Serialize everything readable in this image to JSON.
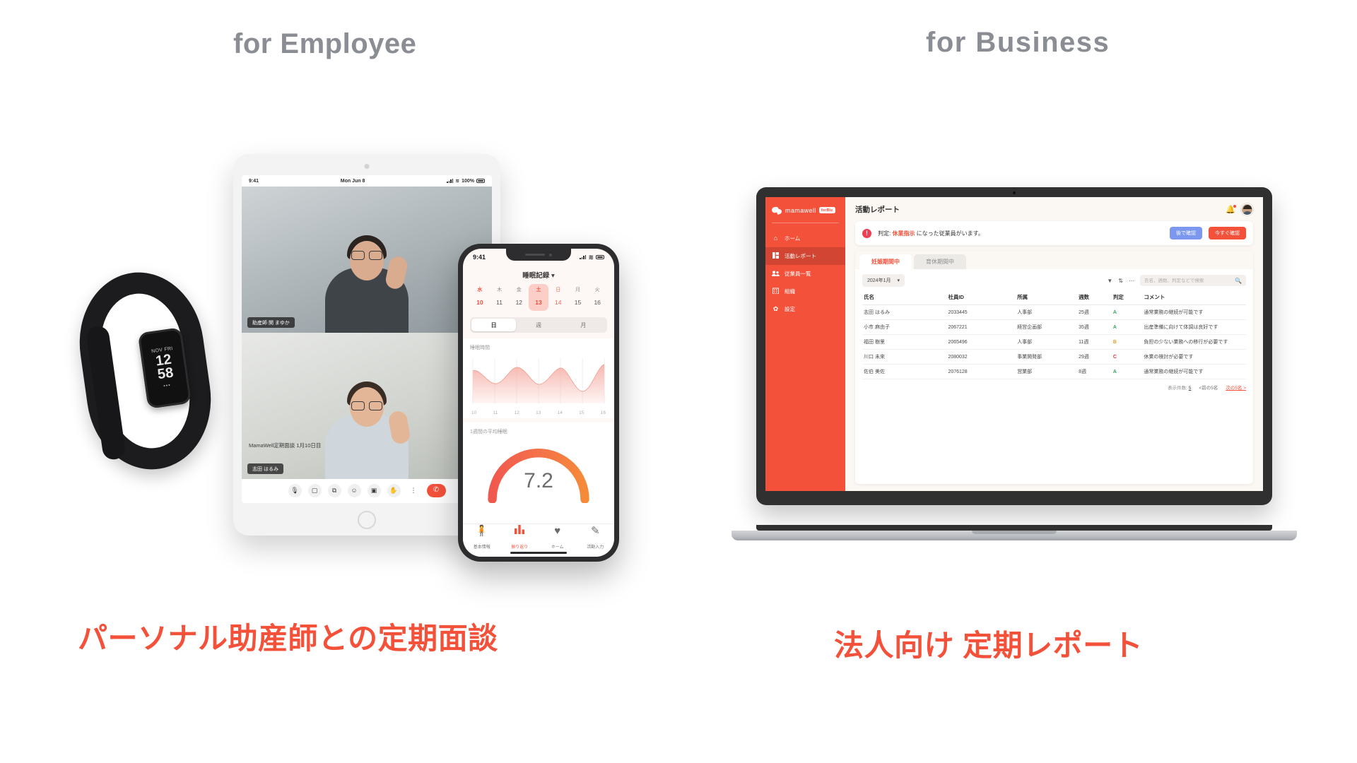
{
  "headings": {
    "employee": "for Employee",
    "business": "for  Business"
  },
  "captions": {
    "left": "パーソナル助産師との定期面談",
    "right": "法人向け 定期レポート"
  },
  "band": {
    "date": "NOV FRI",
    "time_top": "12",
    "time_bottom": "58",
    "dots": "•••"
  },
  "tablet": {
    "status": {
      "time": "9:41",
      "date": "Mon Jun 8",
      "battery": "100%"
    },
    "participants": [
      {
        "name": "助産師 関 まゆか"
      },
      {
        "name": "志田 はるみ"
      }
    ],
    "meeting_title": "MamaWell定期面談 1月10日目",
    "call_buttons": [
      {
        "icon": "microphone-icon",
        "glyph": "🎙"
      },
      {
        "icon": "video-icon",
        "glyph": "▢"
      },
      {
        "icon": "screen-share-icon",
        "glyph": "⧉"
      },
      {
        "icon": "emoji-icon",
        "glyph": "☺"
      },
      {
        "icon": "layout-icon",
        "glyph": "▣"
      },
      {
        "icon": "raise-hand-icon",
        "glyph": "✋"
      },
      {
        "icon": "more-icon",
        "glyph": "⋮"
      },
      {
        "icon": "end-call-icon",
        "glyph": "✆"
      }
    ]
  },
  "phone": {
    "status": {
      "time": "9:41"
    },
    "title": "睡眠記録",
    "title_caret": "▾",
    "days": [
      {
        "dow": "水",
        "num": "10",
        "selected": false,
        "sunday": false
      },
      {
        "dow": "木",
        "num": "11",
        "selected": false,
        "sunday": false
      },
      {
        "dow": "金",
        "num": "12",
        "selected": false,
        "sunday": false
      },
      {
        "dow": "土",
        "num": "13",
        "selected": true,
        "sunday": false
      },
      {
        "dow": "日",
        "num": "14",
        "selected": false,
        "sunday": true
      },
      {
        "dow": "月",
        "num": "15",
        "selected": false,
        "sunday": false
      },
      {
        "dow": "火",
        "num": "16",
        "selected": false,
        "sunday": false
      }
    ],
    "segments": [
      {
        "label": "日",
        "active": true
      },
      {
        "label": "週",
        "active": false
      },
      {
        "label": "月",
        "active": false
      }
    ],
    "chart_label": "睡眠時間",
    "gauge_label": "1週間の平均睡眠",
    "gauge_value": "7.2",
    "tabbar": [
      {
        "label": "基本情報",
        "icon": "pregnant-person-icon",
        "glyph": "🧍",
        "active": false
      },
      {
        "label": "振り返り",
        "icon": "bar-chart-icon",
        "glyph": "▮",
        "active": true
      },
      {
        "label": "ホーム",
        "icon": "heart-icon",
        "glyph": "♥",
        "active": false
      },
      {
        "label": "活動入力",
        "icon": "pencil-icon",
        "glyph": "✎",
        "active": false
      }
    ]
  },
  "chart_data": {
    "type": "area",
    "title": "睡眠時間",
    "x": [
      "10",
      "11",
      "12",
      "13",
      "14",
      "15",
      "16"
    ],
    "values": [
      7.4,
      6.6,
      7.6,
      6.5,
      7.5,
      5.9,
      7.8
    ],
    "xlabel": "",
    "ylabel": "睡眠時間",
    "ylim": [
      0,
      9
    ],
    "grid": true,
    "legend": "none",
    "gauge": {
      "type": "gauge",
      "label": "1週間の平均睡眠",
      "value": 7.2,
      "min": 0,
      "max": 12
    }
  },
  "dashboard": {
    "brand": {
      "name": "mamawell",
      "badge": "forBiz"
    },
    "nav": [
      {
        "label": "ホーム",
        "icon": "home-icon",
        "glyph": "⌂",
        "active": false
      },
      {
        "label": "活動レポート",
        "icon": "report-icon",
        "glyph": "▦",
        "active": true
      },
      {
        "label": "従業員一覧",
        "icon": "people-icon",
        "glyph": "👥",
        "active": false
      },
      {
        "label": "組織",
        "icon": "building-icon",
        "glyph": "🏢",
        "active": false
      },
      {
        "label": "設定",
        "icon": "gear-icon",
        "glyph": "✿",
        "active": false
      }
    ],
    "page_title": "活動レポート",
    "alert": {
      "icon": "alert-exclamation-icon",
      "prefix": "判定: ",
      "highlight": "休業指示",
      "suffix": " になった従業員がいます。",
      "btn_later": "後で確認",
      "btn_now": "今すぐ確認"
    },
    "tabs": [
      {
        "label": "妊娠期間中",
        "active": true
      },
      {
        "label": "育休期間中",
        "active": false
      }
    ],
    "toolbar": {
      "month": "2024年1月",
      "month_caret": "▾",
      "filter_icon": "filter-icon",
      "sort_icon": "sort-icon",
      "more_icon": "more-horizontal-icon",
      "search_placeholder": "氏名、週数、判定などで検索",
      "search_value": "",
      "search_icon": "search-icon"
    },
    "table": {
      "columns": [
        "氏名",
        "社員ID",
        "所属",
        "週数",
        "判定",
        "コメント"
      ],
      "rows": [
        {
          "name": "志田 はるみ",
          "id": "2033445",
          "dept": "人事部",
          "weeks": "25週",
          "grade": "A",
          "comment": "通常業務の継続が可能です"
        },
        {
          "name": "小市 麻由子",
          "id": "2067221",
          "dept": "経営企画部",
          "weeks": "35週",
          "grade": "A",
          "comment": "出産準備に向けて体調は良好です"
        },
        {
          "name": "福田 樹里",
          "id": "2065496",
          "dept": "人事部",
          "weeks": "11週",
          "grade": "B",
          "comment": "負担の少ない業務への移行が必要です"
        },
        {
          "name": "川口 未來",
          "id": "2080032",
          "dept": "事業開発部",
          "weeks": "29週",
          "grade": "C",
          "comment": "休業の検討が必要です"
        },
        {
          "name": "佐伯 美佐",
          "id": "2076128",
          "dept": "営業部",
          "weeks": "8週",
          "grade": "A",
          "comment": "通常業務の継続が可能です"
        }
      ],
      "footer": {
        "count_label": "表示件数:",
        "count_value": "5",
        "prev": "<前の5名",
        "next": "次の5名 >"
      }
    },
    "colors": {
      "brand": "#f4513b",
      "later": "#7b97f0",
      "gradeA": "#3da35d",
      "gradeB": "#e0a32e",
      "gradeC": "#e0344b"
    }
  }
}
